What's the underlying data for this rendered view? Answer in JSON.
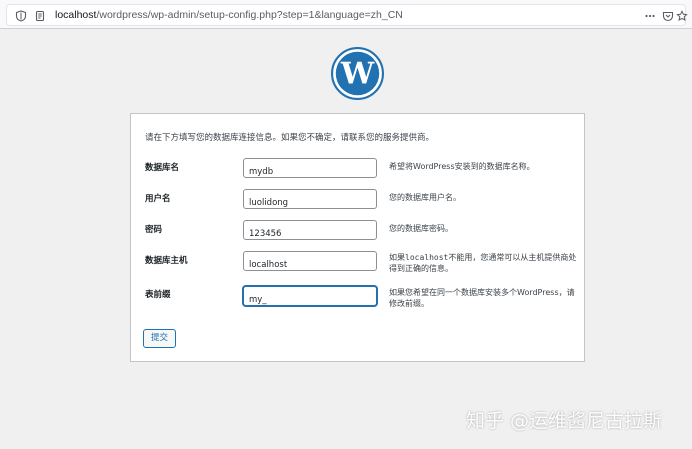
{
  "browser": {
    "url_host": "localhost",
    "url_path": "/wordpress/wp-admin/setup-config.php?step=1&language=zh_CN"
  },
  "logo": {
    "name": "wordpress-logo",
    "color": "#2271b1"
  },
  "form": {
    "intro": "请在下方填写您的数据库连接信息。如果您不确定，请联系您的服务提供商。",
    "fields": [
      {
        "label": "数据库名",
        "value": "mydb",
        "help": "希望将WordPress安装到的数据库名称。"
      },
      {
        "label": "用户名",
        "value": "luolidong",
        "help": "您的数据库用户名。"
      },
      {
        "label": "密码",
        "value": "123456",
        "help": "您的数据库密码。"
      },
      {
        "label": "数据库主机",
        "value": "localhost",
        "help_code": "localhost",
        "help_prefix": "如果",
        "help_suffix": "不能用，您通常可以从主机提供商处得到正确的信息。"
      },
      {
        "label": "表前缀",
        "value": "my_",
        "help": "如果您希望在同一个数据库安装多个WordPress，请修改前缀。"
      }
    ],
    "submit_label": "提交"
  },
  "watermark": "知乎 @运维酱尼古拉斯",
  "colors": {
    "accent": "#2271b1",
    "background": "#f0f0f1"
  }
}
